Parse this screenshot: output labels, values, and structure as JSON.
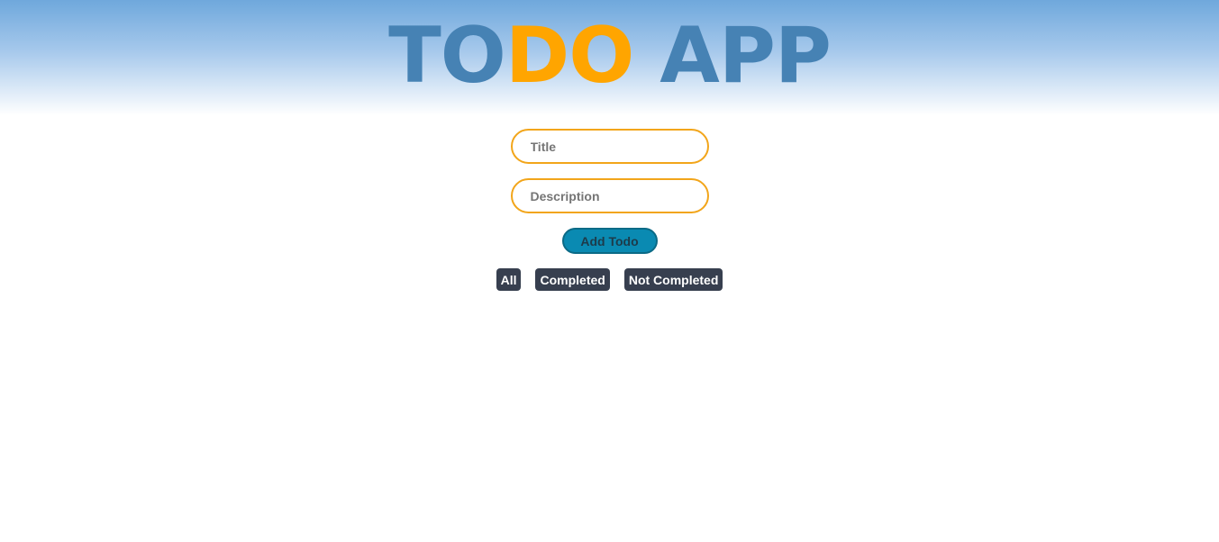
{
  "header": {
    "title_part1": "TO",
    "title_part2": "DO",
    "title_part3": " APP"
  },
  "form": {
    "title_placeholder": "Title",
    "title_value": "",
    "description_placeholder": "Description",
    "description_value": "",
    "add_button_label": "Add Todo"
  },
  "filters": {
    "all_label": "All",
    "completed_label": "Completed",
    "not_completed_label": "Not Completed"
  },
  "colors": {
    "title_blue": "#4682b4",
    "title_orange": "#ffa500",
    "input_border": "#f2a51a",
    "add_button_bg": "#0a8ab2",
    "filter_button_bg": "#373f4f"
  }
}
